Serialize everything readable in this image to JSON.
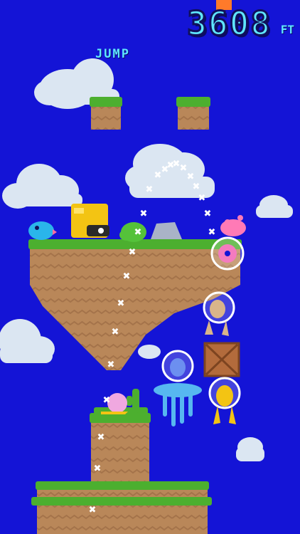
{
  "hud": {
    "altitude": "3608",
    "altitude_unit": "FT",
    "action_label": "JUMP"
  },
  "colors": {
    "sky": "#1414d6",
    "grass": "#4caf2f",
    "dirt": "#b5835a",
    "cloud": "#dbe6f2",
    "hud_text": "#5fe6ff"
  },
  "icons": {
    "path_marker": "x-marker",
    "blue_bird": "bird",
    "yellow_robot": "robot",
    "pink_blob": "pink-alien",
    "rescue_bubbles": [
      "pink-donut-bubble",
      "tan-alien-bubble",
      "blue-alien-bubble",
      "yellow-alien-bubble"
    ]
  }
}
